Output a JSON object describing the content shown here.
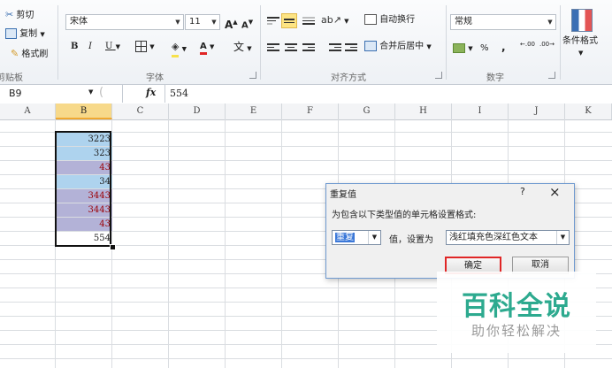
{
  "ribbon": {
    "clipboard": {
      "cut": "剪切",
      "copy": "复制",
      "format_painter": "格式刷",
      "group_label": "剪贴板"
    },
    "font": {
      "name": "宋体",
      "size": "11",
      "grow": "A",
      "shrink": "A",
      "bold": "B",
      "italic": "I",
      "underline": "U",
      "phonetic": "文",
      "font_color_glyph": "A",
      "group_label": "字体"
    },
    "alignment": {
      "wrap_text": "自动换行",
      "merge_center": "合并后居中",
      "group_label": "对齐方式"
    },
    "number": {
      "format": "常规",
      "percent": "%",
      "comma": ",",
      "inc_decimal": ".00",
      "dec_decimal": ".00",
      "group_label": "数字"
    },
    "styles": {
      "conditional_format": "条件格式"
    }
  },
  "formula_bar": {
    "name_box": "B9",
    "fx": "fx",
    "value": "554"
  },
  "columns": [
    "A",
    "B",
    "C",
    "D",
    "E",
    "F",
    "G",
    "H",
    "I",
    "J",
    "K"
  ],
  "selected_column": "B",
  "cells": [
    {
      "value": "3223",
      "highlight": "light-blue"
    },
    {
      "value": "323",
      "highlight": "light-blue"
    },
    {
      "value": "43",
      "highlight": "duplicate"
    },
    {
      "value": "34",
      "highlight": "light-blue"
    },
    {
      "value": "3443",
      "highlight": "duplicate"
    },
    {
      "value": "3443",
      "highlight": "duplicate"
    },
    {
      "value": "43",
      "highlight": "duplicate"
    },
    {
      "value": "554",
      "highlight": "none"
    }
  ],
  "colors": {
    "light_blue_fill": "#aed3ee",
    "duplicate_fill": "#b3b2d7",
    "duplicate_text": "#9c0006",
    "normal_text": "#1f1f1f",
    "highlight_red": "#e02626",
    "selected_header": "#f7d98a"
  },
  "dialog": {
    "title": "重复值",
    "help": "?",
    "close": "×",
    "description": "为包含以下类型值的单元格设置格式:",
    "type_value": "重复",
    "value_label": "值，设置为",
    "format_value": "浅红填充色深红色文本",
    "ok": "确定",
    "cancel": "取消"
  },
  "watermark": {
    "main": "百科全说",
    "sub": "助你轻松解决"
  }
}
